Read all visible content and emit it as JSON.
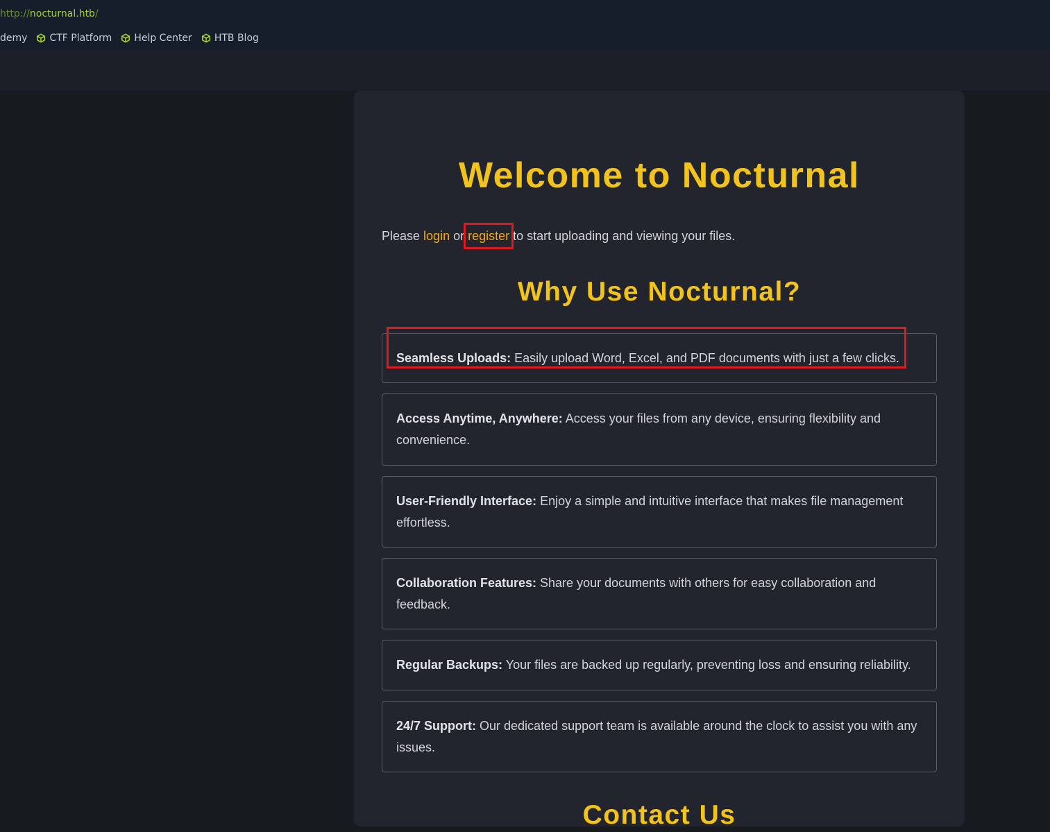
{
  "browser": {
    "url": {
      "scheme": "http://",
      "host": "nocturnal.htb",
      "path": "/"
    },
    "bookmarks": [
      {
        "label": "demy",
        "icon": "none"
      },
      {
        "label": "CTF Platform",
        "icon": "cube-icon"
      },
      {
        "label": "Help Center",
        "icon": "cube-icon"
      },
      {
        "label": "HTB Blog",
        "icon": "cube-icon"
      }
    ]
  },
  "page": {
    "title": "Welcome to Nocturnal",
    "intro": {
      "prefix": "Please ",
      "login": "login",
      "or": " or ",
      "register": "register",
      "suffix": " to start uploading and viewing your files."
    },
    "why_title": "Why Use Nocturnal?",
    "features": [
      {
        "heading": "Seamless Uploads:",
        "text": " Easily upload Word, Excel, and PDF documents with just a few clicks."
      },
      {
        "heading": "Access Anytime, Anywhere:",
        "text": " Access your files from any device, ensuring flexibility and convenience."
      },
      {
        "heading": "User-Friendly Interface:",
        "text": " Enjoy a simple and intuitive interface that makes file management effortless."
      },
      {
        "heading": "Collaboration Features:",
        "text": " Share your documents with others for easy collaboration and feedback."
      },
      {
        "heading": "Regular Backups:",
        "text": " Your files are backed up regularly, preventing loss and ensuring reliability."
      },
      {
        "heading": "24/7 Support:",
        "text": " Our dedicated support team is available around the clock to assist you with any issues."
      }
    ],
    "contact_title": "Contact Us"
  },
  "colors": {
    "accent_yellow": "#f2c31c",
    "link_orange": "#f2a81e",
    "highlight_red": "#e0191c",
    "bookmark_icon_green": "#a3d12d"
  }
}
